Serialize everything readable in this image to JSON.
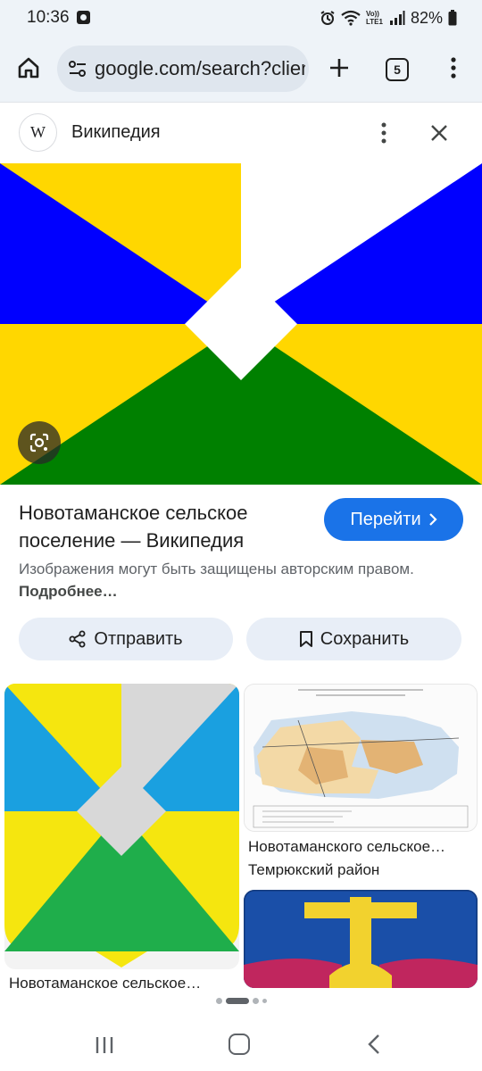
{
  "status_bar": {
    "time": "10:36",
    "network_label": "Vo)) LTE1",
    "battery": "82%"
  },
  "toolbar": {
    "url": "google.com/search?client",
    "tab_count": "5"
  },
  "panel": {
    "source_name": "Википедия",
    "source_logo": "W",
    "title": "Новотаманское сельское поселение — Википедия",
    "visit_label": "Перейти",
    "copyright_text": "Изображения могут быть защищены авторским правом.",
    "copyright_link": "Подробнее…",
    "share_label": "Отправить",
    "save_label": "Сохранить"
  },
  "related": [
    {
      "caption": "Новотаманское сельское…"
    },
    {
      "caption": "Новотаманского сельское…",
      "subcaption": "Темрюкский район"
    },
    {
      "caption": ""
    }
  ],
  "colors": {
    "flag_blue": "#0000ff",
    "flag_yellow": "#ffd700",
    "flag_green": "#008000",
    "accent_blue": "#1a73e8"
  },
  "icons": [
    "home-icon",
    "site-info-icon",
    "plus-icon",
    "more-vert-icon",
    "close-icon",
    "google-lens-icon",
    "share-icon",
    "bookmark-icon",
    "chevron-right-icon"
  ]
}
